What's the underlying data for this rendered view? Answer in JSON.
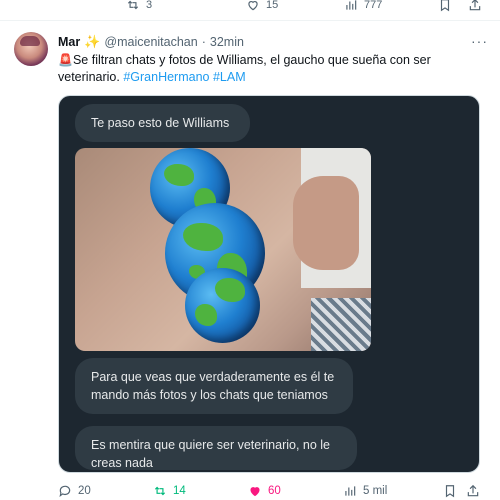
{
  "prev_tweet": {
    "retweets": "3",
    "likes": "15",
    "views": "777"
  },
  "tweet": {
    "author_name": "Mar",
    "author_badge": "✨",
    "handle": "@maicenitachan",
    "separator": "·",
    "time": "32min",
    "more": "···",
    "text_emoji": "🚨",
    "text": "Se filtran chats y fotos de Williams, el gaucho que sueña con ser veterinario.",
    "hashtag_1": "#GranHermano",
    "hashtag_2": "#LAM"
  },
  "media": {
    "message_1": "Te paso esto de Williams",
    "message_2": "Para que veas que verdaderamente es él te mando más fotos y los chats que teniamos",
    "message_3": "Es mentira que quiere ser veterinario, no le creas nada"
  },
  "actions": {
    "replies": "20",
    "retweets": "14",
    "likes": "60",
    "views": "5 mil"
  },
  "icons": {
    "reply": "reply-icon",
    "retweet": "retweet-icon",
    "like": "heart-icon",
    "views": "views-icon",
    "bookmark": "bookmark-icon",
    "share": "share-icon",
    "more": "more-icon"
  },
  "colors": {
    "accent": "#1d9bf0",
    "retweet": "#00ba7c",
    "like": "#f91880",
    "muted": "#536471"
  }
}
